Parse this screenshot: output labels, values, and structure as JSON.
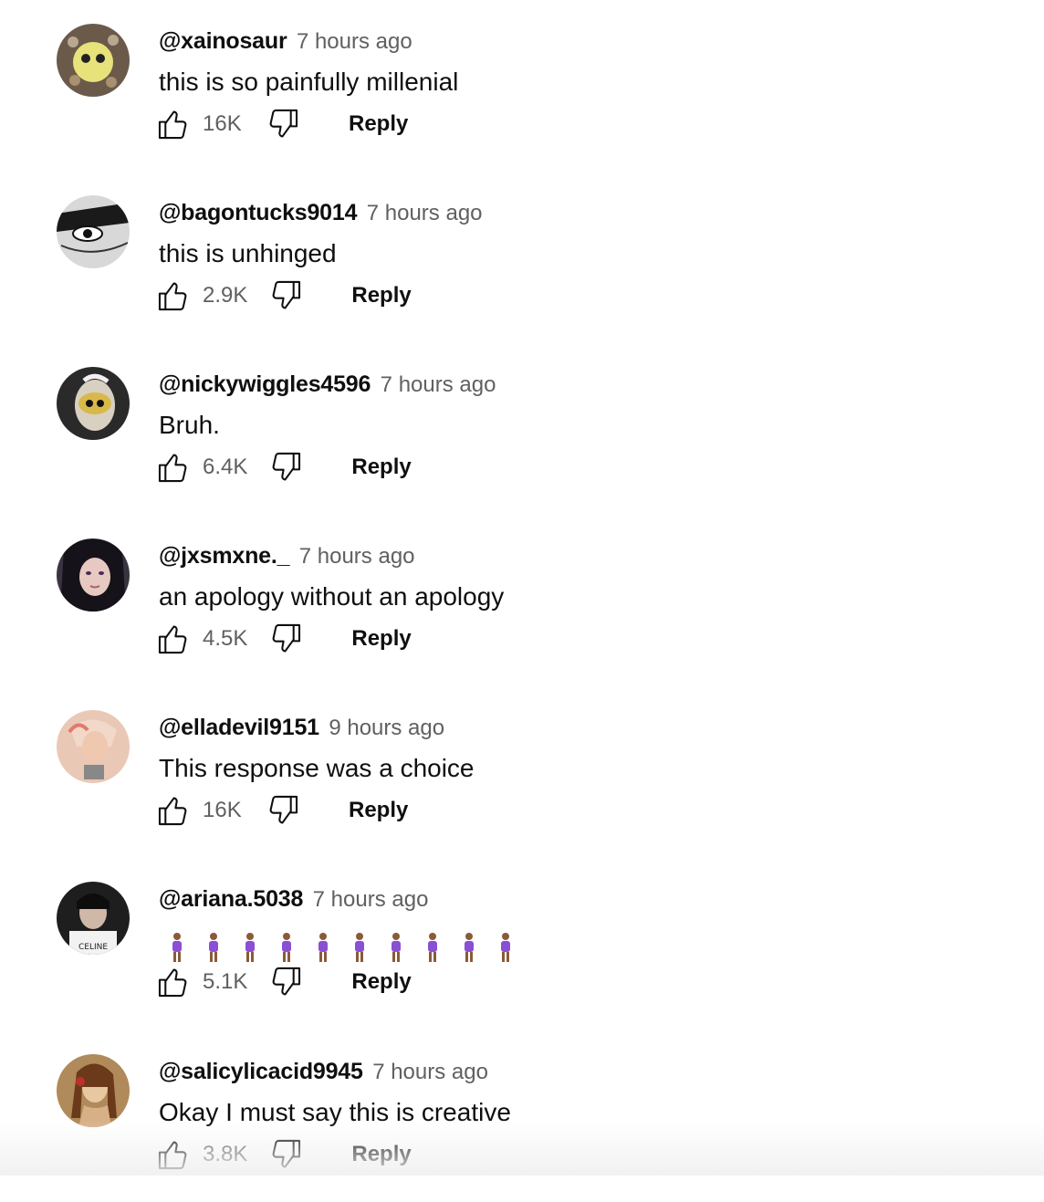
{
  "comments": [
    {
      "author": "@xainosaur",
      "time": "7 hours ago",
      "text": "this is so painfully millenial",
      "likes": "16K",
      "reply": "Reply",
      "avatar_color": "#6b5a4a"
    },
    {
      "author": "@bagontucks9014",
      "time": "7 hours ago",
      "text": "this is unhinged",
      "likes": "2.9K",
      "reply": "Reply",
      "avatar_color": "#d8d8d8"
    },
    {
      "author": "@nickywiggles4596",
      "time": "7 hours ago",
      "text": "Bruh.",
      "likes": "6.4K",
      "reply": "Reply",
      "avatar_color": "#2a2a2a"
    },
    {
      "author": "@jxsmxne._",
      "time": "7 hours ago",
      "text": "an apology without an apology",
      "likes": "4.5K",
      "reply": "Reply",
      "avatar_color": "#3a3340"
    },
    {
      "author": "@elladevil9151",
      "time": "9 hours ago",
      "text": "This response was a choice",
      "likes": "16K",
      "reply": "Reply",
      "avatar_color": "#e9c8b6"
    },
    {
      "author": "@ariana.5038",
      "time": "7 hours ago",
      "text": "",
      "emoji": "woman-standing-emoji",
      "emoji_count": 10,
      "likes": "5.1K",
      "reply": "Reply",
      "avatar_color": "#1e1e1e"
    },
    {
      "author": "@salicylicacid9945",
      "time": "7 hours ago",
      "text": "Okay I must say this is creative",
      "likes": "3.8K",
      "reply": "Reply",
      "avatar_color": "#b08a5a"
    }
  ],
  "icons": {
    "like": "thumbs-up-icon",
    "dislike": "thumbs-down-icon"
  },
  "colors": {
    "text_primary": "#0f0f0f",
    "text_secondary": "#606060",
    "background": "#ffffff"
  }
}
